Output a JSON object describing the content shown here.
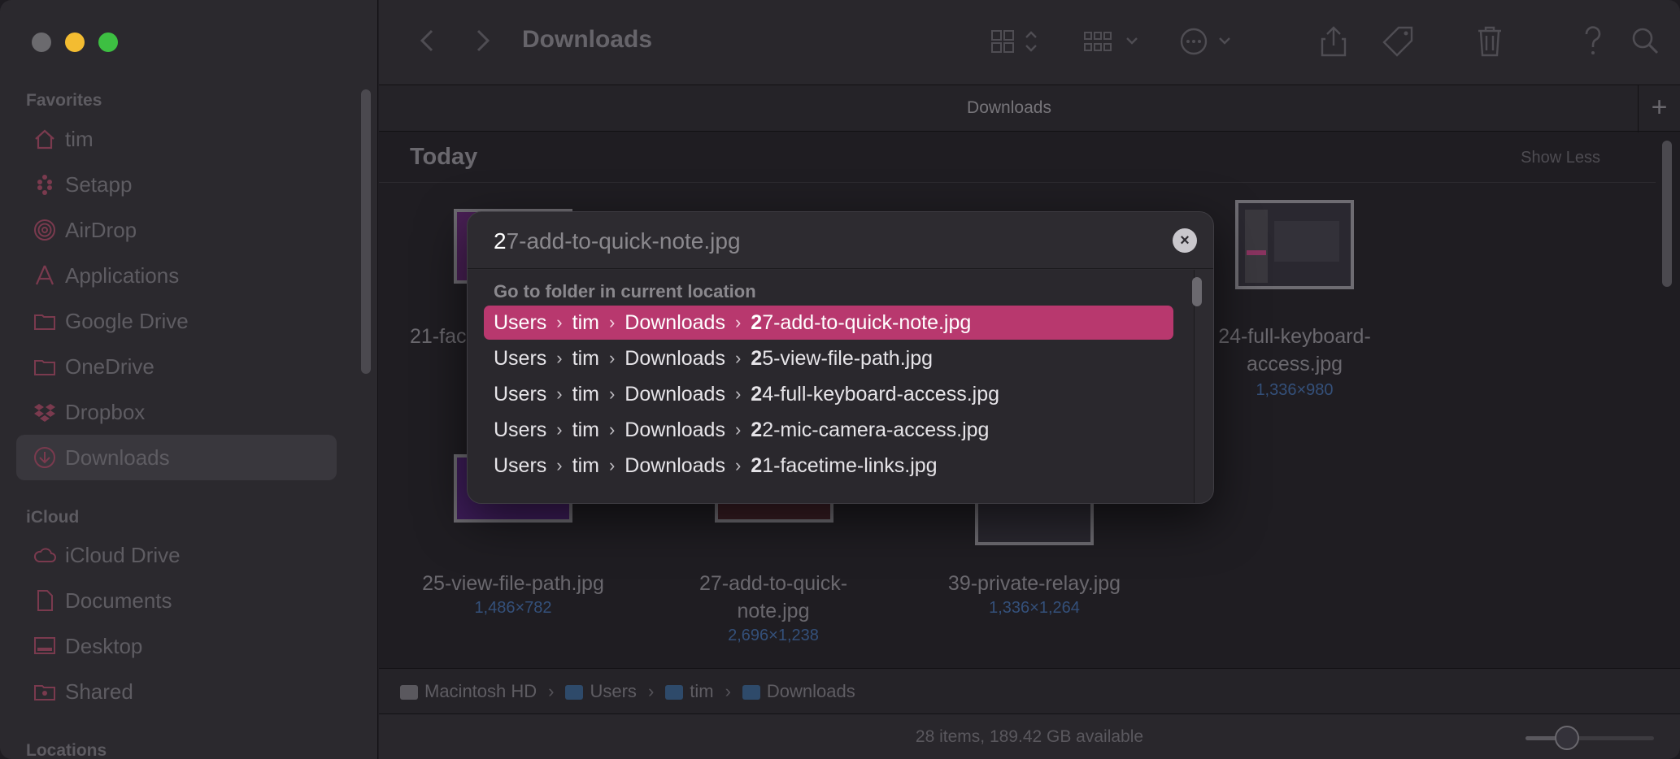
{
  "window": {
    "title": "Downloads"
  },
  "sidebar": {
    "favorites_label": "Favorites",
    "favorites": [
      {
        "label": "tim",
        "icon": "home-icon"
      },
      {
        "label": "Setapp",
        "icon": "setapp-icon"
      },
      {
        "label": "AirDrop",
        "icon": "airdrop-icon"
      },
      {
        "label": "Applications",
        "icon": "applications-icon"
      },
      {
        "label": "Google Drive",
        "icon": "folder-icon"
      },
      {
        "label": "OneDrive",
        "icon": "folder-icon"
      },
      {
        "label": "Dropbox",
        "icon": "dropbox-icon"
      },
      {
        "label": "Downloads",
        "icon": "downloads-icon"
      }
    ],
    "icloud_label": "iCloud",
    "icloud": [
      {
        "label": "iCloud Drive",
        "icon": "cloud-icon"
      },
      {
        "label": "Documents",
        "icon": "document-icon"
      },
      {
        "label": "Desktop",
        "icon": "desktop-icon"
      },
      {
        "label": "Shared",
        "icon": "shared-folder-icon"
      }
    ],
    "locations_label": "Locations"
  },
  "toolbar": {
    "title": "Downloads"
  },
  "tabbar": {
    "title": "Downloads",
    "add": "+"
  },
  "content": {
    "section_title": "Today",
    "show_less": "Show Less",
    "files": [
      {
        "name": "21-fac",
        "dims": ""
      },
      {
        "name": "24-full-keyboard-access.jpg",
        "name_line1": "24-full-keyboard-",
        "name_line2": "access.jpg",
        "dims": "1,336×980"
      },
      {
        "name": "25-view-file-path.jpg",
        "dims": "1,486×782"
      },
      {
        "name": "27-add-to-quick-note.jpg",
        "name_line1": "27-add-to-quick-",
        "name_line2": "note.jpg",
        "dims": "2,696×1,238"
      },
      {
        "name": "39-private-relay.jpg",
        "dims": "1,336×1,264"
      }
    ]
  },
  "pathbar": {
    "items": [
      "Macintosh HD",
      "Users",
      "tim",
      "Downloads"
    ]
  },
  "statusbar": {
    "text": "28 items, 189.42 GB available",
    "zoom_fraction": 0.25
  },
  "goto_popup": {
    "typed": "2",
    "completion": "7-add-to-quick-note.jpg",
    "clear_label": "×",
    "list_header": "Go to folder in current location",
    "results": [
      {
        "path": [
          "Users",
          "tim",
          "Downloads"
        ],
        "match": "2",
        "rest": "7-add-to-quick-note.jpg",
        "selected": true
      },
      {
        "path": [
          "Users",
          "tim",
          "Downloads"
        ],
        "match": "2",
        "rest": "5-view-file-path.jpg",
        "selected": false
      },
      {
        "path": [
          "Users",
          "tim",
          "Downloads"
        ],
        "match": "2",
        "rest": "4-full-keyboard-access.jpg",
        "selected": false
      },
      {
        "path": [
          "Users",
          "tim",
          "Downloads"
        ],
        "match": "2",
        "rest": "2-mic-camera-access.jpg",
        "selected": false
      },
      {
        "path": [
          "Users",
          "tim",
          "Downloads"
        ],
        "match": "2",
        "rest": "1-facetime-links.jpg",
        "selected": false
      }
    ],
    "path_separator": "›"
  },
  "colors": {
    "accent": "#b8386e",
    "traffic_min": "#f3bc31",
    "traffic_max": "#3dbf42"
  }
}
